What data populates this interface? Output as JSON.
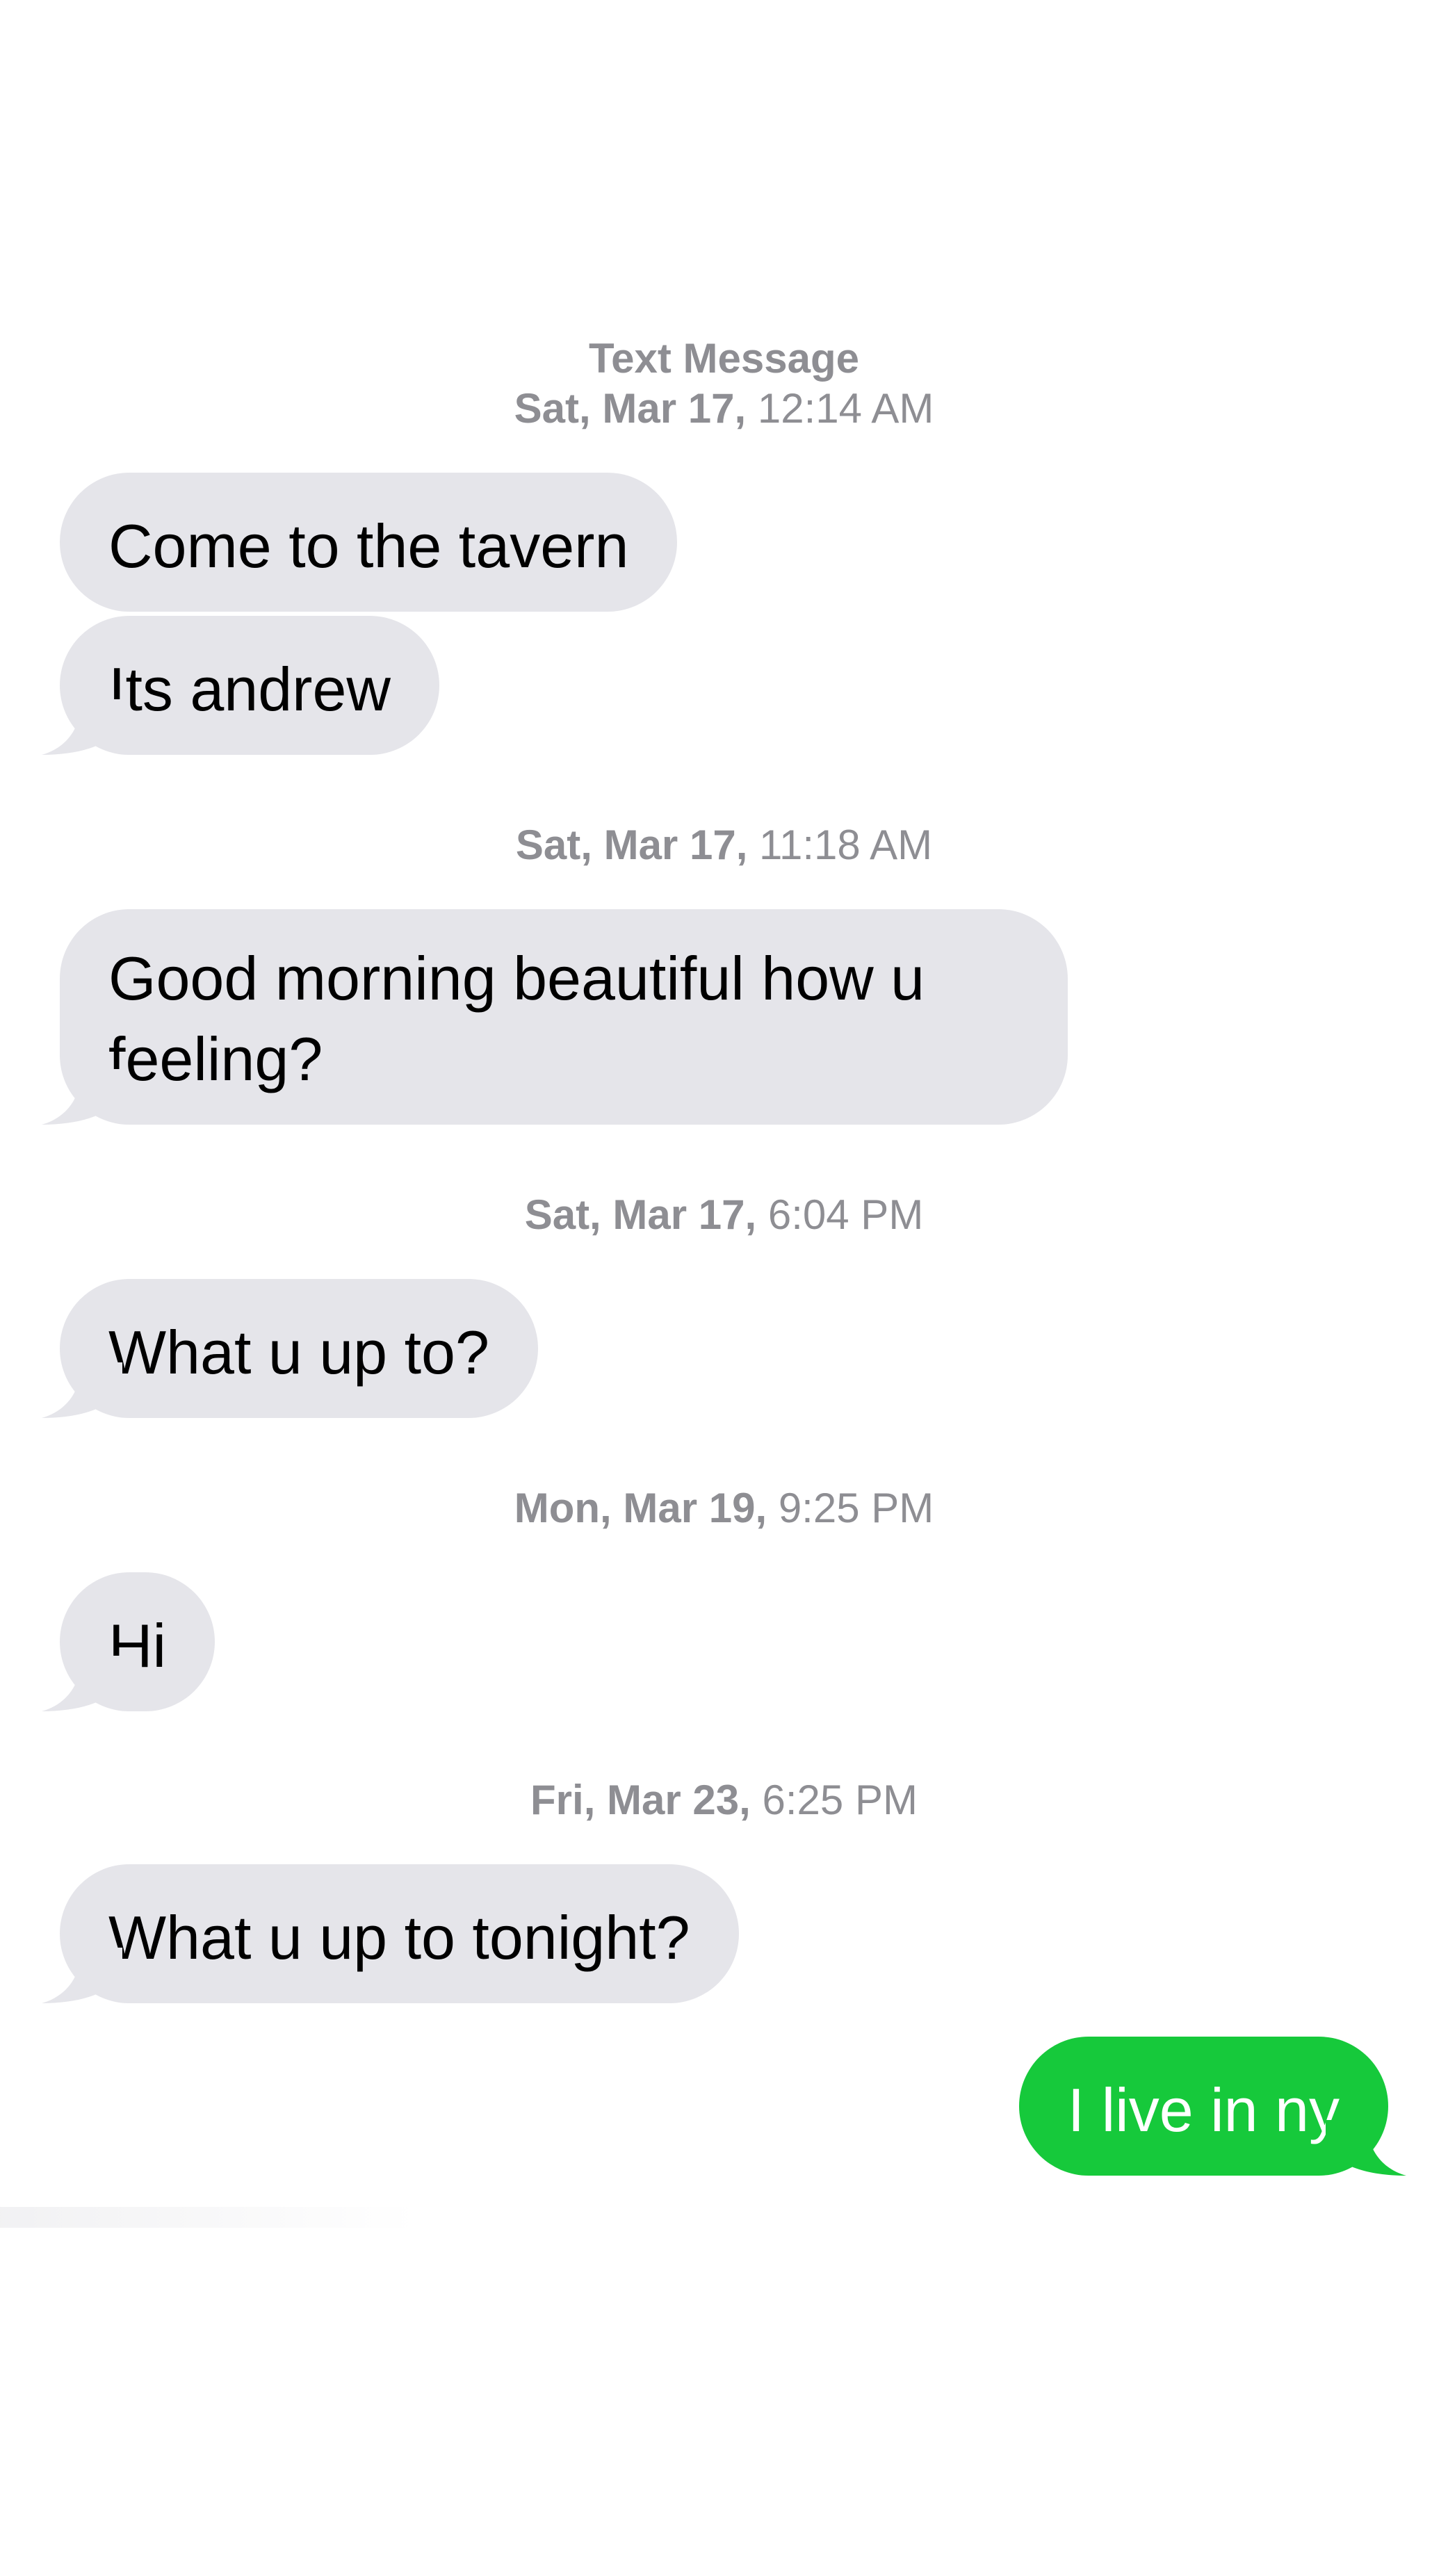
{
  "conversation": {
    "header": {
      "service": "Text Message",
      "groups": [
        {
          "day": "Sat, Mar 17,",
          "time": "12:14 AM"
        },
        {
          "day": "Sat, Mar 17,",
          "time": "11:18 AM"
        },
        {
          "day": "Sat, Mar 17,",
          "time": "6:04 PM"
        },
        {
          "day": "Mon, Mar 19,",
          "time": "9:25 PM"
        },
        {
          "day": "Fri, Mar 23,",
          "time": "6:25 PM"
        }
      ]
    },
    "messages": [
      {
        "from": "them",
        "text": "Come to the tavern"
      },
      {
        "from": "them",
        "text": "Its andrew"
      },
      {
        "from": "them",
        "text": "Good morning beautiful how u feeling?"
      },
      {
        "from": "them",
        "text": "What u up to?"
      },
      {
        "from": "them",
        "text": "Hi"
      },
      {
        "from": "them",
        "text": "What u up to tonight?"
      },
      {
        "from": "me",
        "text": "I live in ny"
      }
    ]
  },
  "colors": {
    "incoming_bubble": "#e5e5ea",
    "outgoing_bubble": "#16c93b",
    "timestamp_text": "#8e8e93"
  }
}
